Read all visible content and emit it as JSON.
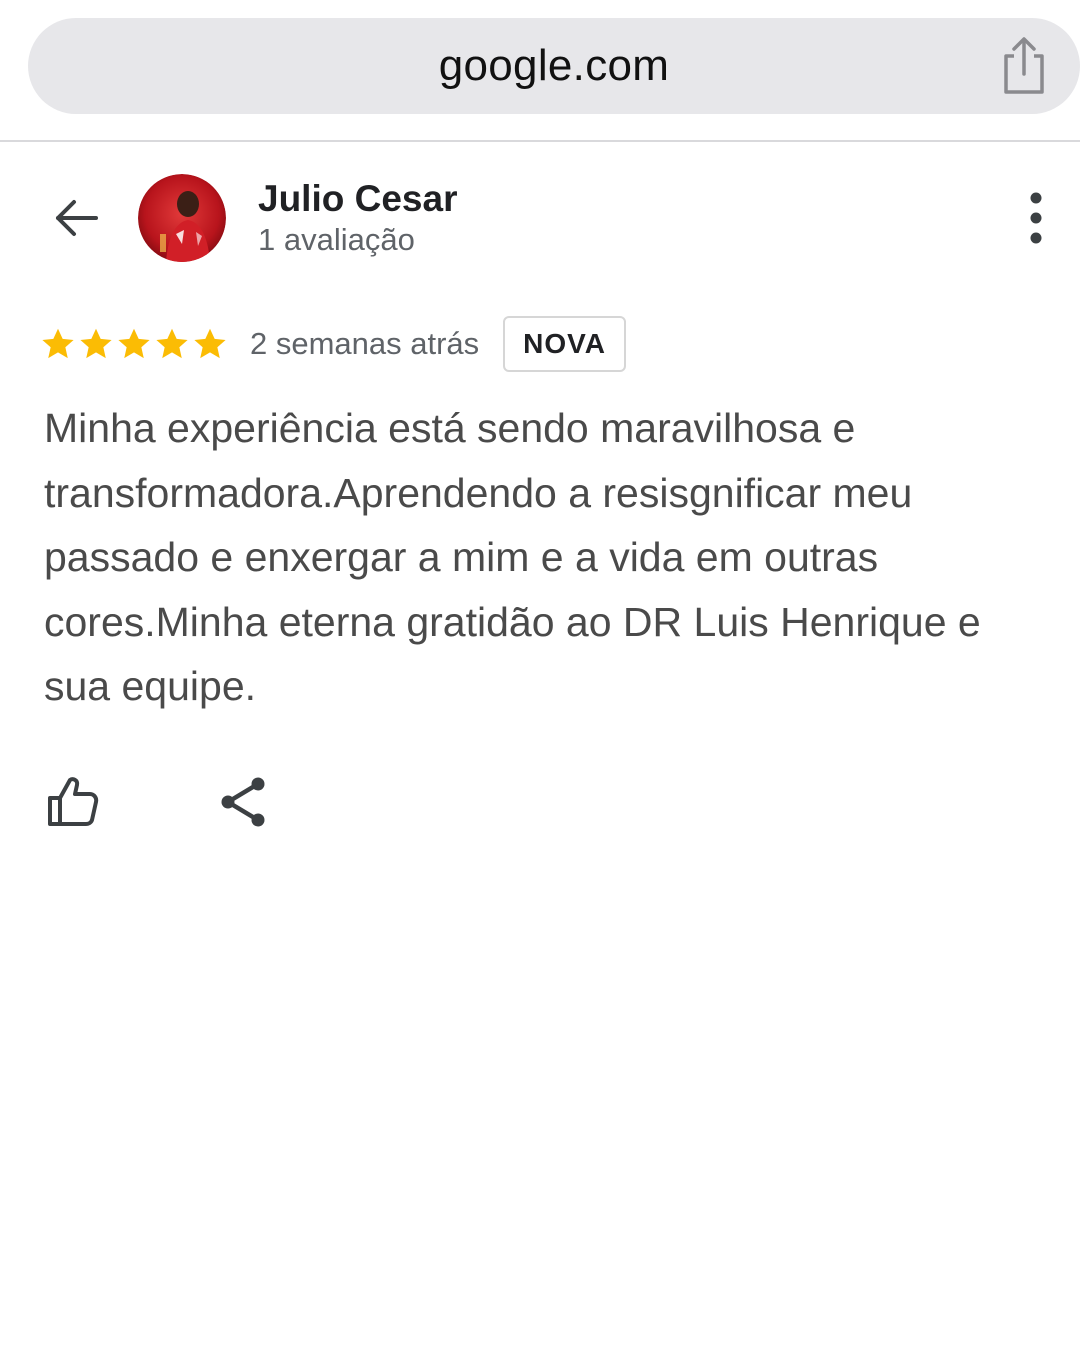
{
  "browser": {
    "url": "google.com",
    "share_icon": "share-ios-icon"
  },
  "reviewer": {
    "name": "Julio Cesar",
    "review_count": "1 avaliação",
    "avatar_icon": "avatar-photo"
  },
  "review": {
    "rating": 5,
    "rating_max": 5,
    "star_color": "#FBBC04",
    "time_ago": "2 semanas atrás",
    "badge": "NOVA",
    "text": "Minha experiência está sendo maravilhosa e transformadora.Aprendendo a resisgnificar meu passado e enxergar a mim e a vida em outras cores.Minha eterna gratidão ao DR Luis Henrique e sua equipe."
  },
  "actions": {
    "like_icon": "thumbs-up-icon",
    "share_icon": "share-icon"
  },
  "icons": {
    "back": "arrow-back-icon",
    "menu": "more-vert-icon"
  }
}
